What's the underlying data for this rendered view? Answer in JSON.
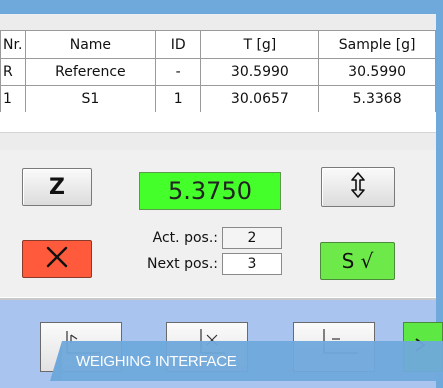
{
  "table": {
    "headers": {
      "nr": "Nr.",
      "name": "Name",
      "id": "ID",
      "t": "T [g]",
      "sample": "Sample [g]"
    },
    "rows": [
      {
        "nr": "R",
        "name": "Reference",
        "id": "-",
        "t": "30.5990",
        "sample": "30.5990"
      },
      {
        "nr": "1",
        "name": "S1",
        "id": "1",
        "t": "30.0657",
        "sample": "5.3368"
      }
    ]
  },
  "controls": {
    "zero_label": "Z",
    "confirm_label": "S √",
    "weight_display": "5.3750",
    "act_pos_label": "Act. pos.:",
    "act_pos_value": "2",
    "next_pos_label": "Next pos.:",
    "next_pos_value": "3"
  },
  "colors": {
    "weight_display": "#44ff2a",
    "cancel_button": "#ff5a3c",
    "confirm_button": "#6ee94a",
    "frame": "#6fa9dc",
    "toolbar": "#a9c4ee"
  },
  "icons": {
    "cancel": "x-icon",
    "swap": "up-down-arrow-icon"
  },
  "caption": "WEIGHING INTERFACE"
}
